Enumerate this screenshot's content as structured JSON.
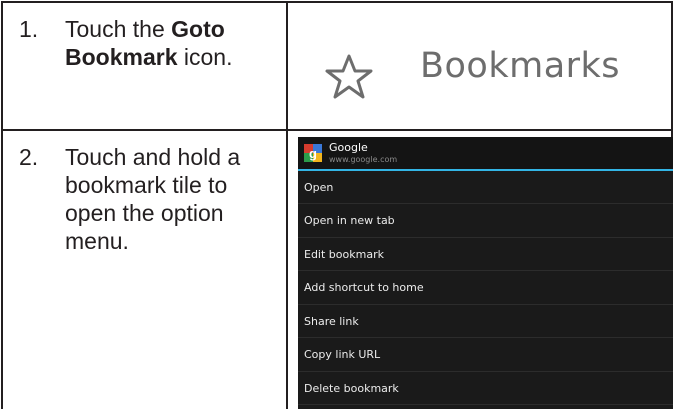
{
  "steps": [
    {
      "number": "1.",
      "text_pre": "Touch the ",
      "text_bold": "Goto Bookmark",
      "text_post": " icon."
    },
    {
      "number": "2.",
      "text": "Touch and hold a bookmark tile to open the option menu."
    }
  ],
  "bookmark_graphic": {
    "icon": "star-outline-icon",
    "label": "Bookmarks",
    "label_color": "#6d6d6d"
  },
  "context_menu": {
    "favicon": "google-favicon-icon",
    "title": "Google",
    "url": "www.google.com",
    "accent_color": "#33b5e5",
    "items": [
      "Open",
      "Open in new tab",
      "Edit bookmark",
      "Add shortcut to home",
      "Share link",
      "Copy link URL",
      "Delete bookmark"
    ]
  }
}
